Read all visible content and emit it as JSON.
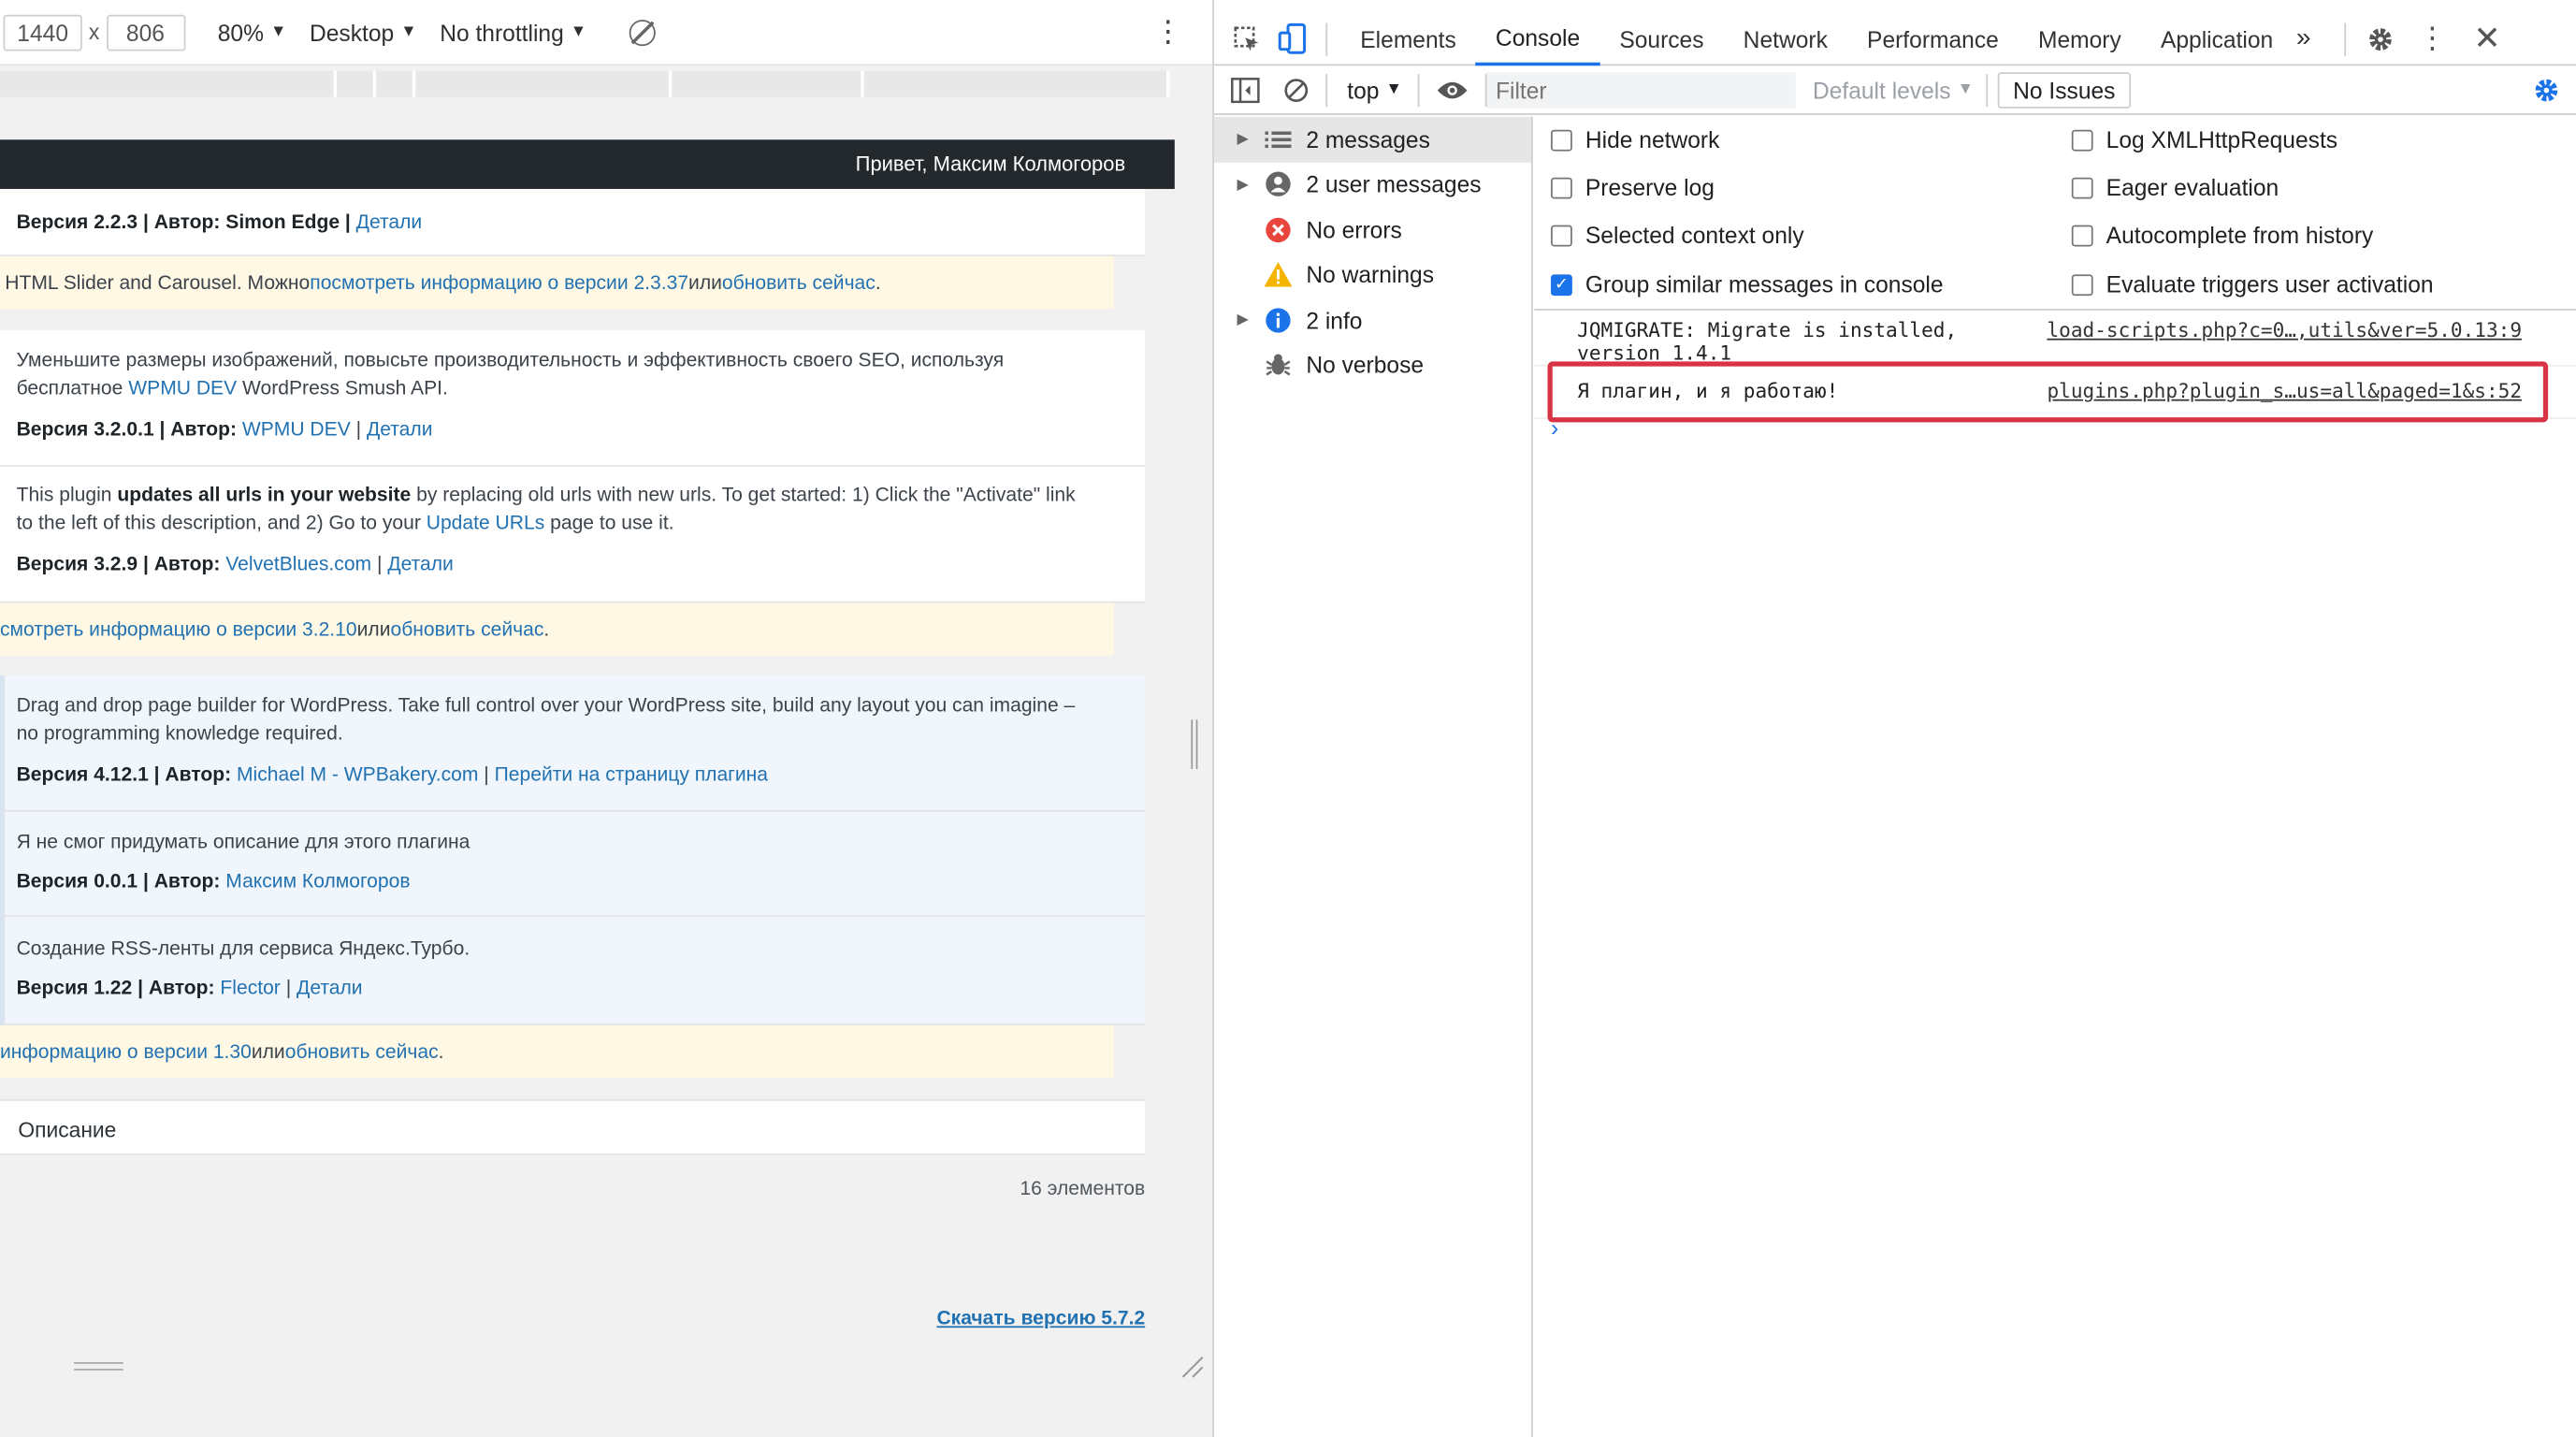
{
  "device_toolbar": {
    "width": "1440",
    "height": "806",
    "times": "x",
    "zoom": "80%",
    "device": "Desktop",
    "throttling": "No throttling"
  },
  "wp": {
    "greeting": "Привет, Максим Колмогоров",
    "plugins": [
      {
        "meta_prefix": "Версия 2.2.3 | Автор: Simon Edge | ",
        "details": "Детали"
      },
      {
        "update_prefix": "HTML Slider and Carousel. Можно ",
        "view": "посмотреть информацию о версии 2.3.37",
        "or": " или ",
        "update": "обновить сейчас",
        "dot": "."
      },
      {
        "desc1": "Уменьшите размеры изображений, повысьте производительность и эффективность своего SEO, используя",
        "desc2_prefix": "бесплатное ",
        "desc2_link": "WPMU DEV",
        "desc2_suffix": " WordPress Smush API.",
        "meta_prefix": "Версия 3.2.0.1 | Автор: ",
        "author": "WPMU DEV",
        "sep": " | ",
        "details": "Детали"
      },
      {
        "desc1_prefix": "This plugin ",
        "desc1_bold": "updates all urls in your website",
        "desc1_suffix": " by replacing old urls with new urls. To get started: 1) Click the \"Activate\" link",
        "desc2_prefix": "to the left of this description, and 2) Go to your ",
        "desc2_link": "Update URLs",
        "desc2_suffix": " page to use it.",
        "meta_prefix": "Версия 3.2.9 | Автор: ",
        "author": "VelvetBlues.com",
        "sep": " | ",
        "details": "Детали"
      },
      {
        "view": "смотреть информацию о версии 3.2.10",
        "or": " или ",
        "update": "обновить сейчас",
        "dot": "."
      },
      {
        "desc1": "Drag and drop page builder for WordPress. Take full control over your WordPress site, build any layout you can imagine –",
        "desc2": "no programming knowledge required.",
        "meta_prefix": "Версия 4.12.1 | Автор: ",
        "author": "Michael M - WPBakery.com",
        "sep": " | ",
        "details": "Перейти на страницу плагина"
      },
      {
        "desc1": "Я не смог придумать описание для этого плагина",
        "meta_prefix": "Версия 0.0.1 | Автор: ",
        "author": "Максим Колмогоров"
      },
      {
        "desc1": "Создание RSS-ленты для сервиса Яндекс.Турбо.",
        "meta_prefix": "Версия 1.22 | Автор: ",
        "author": "Flector",
        "sep": " | ",
        "details": "Детали"
      },
      {
        "view": "информацию о версии 1.30",
        "or": " или ",
        "update": "обновить сейчас",
        "dot": "."
      }
    ],
    "footer_col": "Описание",
    "count": "16 элементов",
    "download": "Скачать версию 5.7.2"
  },
  "devtools": {
    "tabs": [
      "Elements",
      "Console",
      "Sources",
      "Network",
      "Performance",
      "Memory",
      "Application"
    ],
    "active_tab": "Console",
    "context": "top",
    "filter_placeholder": "Filter",
    "levels": "Default levels",
    "issues": "No Issues",
    "sidebar": [
      {
        "label": "2 messages",
        "icon": "list-icon"
      },
      {
        "label": "2 user messages",
        "icon": "user-icon"
      },
      {
        "label": "No errors",
        "icon": "error-icon"
      },
      {
        "label": "No warnings",
        "icon": "warning-icon"
      },
      {
        "label": "2 info",
        "icon": "info-icon"
      },
      {
        "label": "No verbose",
        "icon": "bug-icon"
      }
    ],
    "settings": [
      {
        "label": "Hide network",
        "checked": false
      },
      {
        "label": "Log XMLHttpRequests",
        "checked": false
      },
      {
        "label": "Preserve log",
        "checked": false
      },
      {
        "label": "Eager evaluation",
        "checked": false
      },
      {
        "label": "Selected context only",
        "checked": false
      },
      {
        "label": "Autocomplete from history",
        "checked": false
      },
      {
        "label": "Group similar messages in console",
        "checked": true
      },
      {
        "label": "Evaluate triggers user activation",
        "checked": false
      }
    ],
    "messages": [
      {
        "text1": "JQMIGRATE: Migrate is installed,",
        "text2": "version 1.4.1",
        "source": "load-scripts.php?c=0…,utils&ver=5.0.13:9"
      },
      {
        "text1": "Я плагин, и я работаю!",
        "source": "plugins.php?plugin_s…us=all&paged=1&s:52"
      }
    ],
    "prompt": "›",
    "highlight_color": "#d93445",
    "accent": "#1a73e8"
  }
}
